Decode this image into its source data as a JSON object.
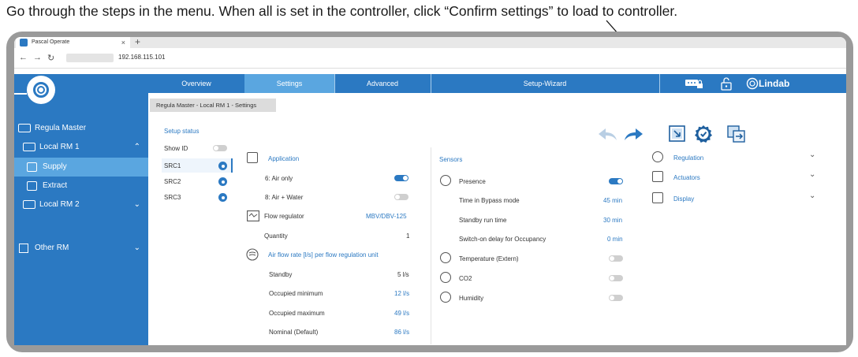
{
  "instruction": "Go through the steps in the menu. When all is set in the controller, click “Confirm settings” to load to controller.",
  "browser": {
    "tab_title": "Pascal Operate",
    "tab_close": "×",
    "new_tab": "+",
    "url": "192.168.115.101",
    "back": "←",
    "forward": "→",
    "reload": "↻"
  },
  "topnav": {
    "tabs": [
      {
        "label": "Overview"
      },
      {
        "label": "Settings",
        "active": true
      },
      {
        "label": "Advanced"
      },
      {
        "label": "Setup-Wizard"
      }
    ],
    "brand": "Lindab"
  },
  "sidebar": {
    "items": [
      {
        "label": "Regula Master",
        "icon": "controller-icon"
      },
      {
        "label": "Local RM 1",
        "icon": "controller-icon",
        "expanded": true
      },
      {
        "label": "Supply",
        "icon": "unit-icon",
        "selected": true
      },
      {
        "label": "Extract",
        "icon": "unit-icon"
      },
      {
        "label": "Local RM 2",
        "icon": "controller-icon",
        "expanded": false
      },
      {
        "label": "Other RM",
        "icon": "building-icon",
        "expanded": false
      }
    ]
  },
  "breadcrumb": "Regula Master - Local RM 1 - Settings",
  "setup": {
    "title": "Setup status",
    "show_id_label": "Show ID",
    "show_id_on": false,
    "srcs": [
      {
        "label": "SRC1",
        "selected": true
      },
      {
        "label": "SRC2"
      },
      {
        "label": "SRC3"
      }
    ]
  },
  "application": {
    "title": "Application",
    "options": [
      {
        "label": "6: Air only",
        "on": true
      },
      {
        "label": "8: Air + Water",
        "on": false
      }
    ],
    "flow_regulator_label": "Flow regulator",
    "flow_regulator_value": "MBV/DBV-125",
    "quantity_label": "Quantity",
    "quantity_value": "1",
    "airflow_title": "Air flow rate [l/s] per flow regulation unit",
    "rates": [
      {
        "label": "Standby",
        "value": "5 l/s"
      },
      {
        "label": "Occupied minimum",
        "value": "12 l/s"
      },
      {
        "label": "Occupied maximum",
        "value": "49 l/s"
      },
      {
        "label": "Nominal (Default)",
        "value": "86 l/s"
      }
    ]
  },
  "sensors": {
    "title": "Sensors",
    "presence_label": "Presence",
    "presence_on": true,
    "presence_settings": [
      {
        "label": "Time in Bypass mode",
        "value": "45 min"
      },
      {
        "label": "Standby run time",
        "value": "30 min"
      },
      {
        "label": "Switch-on delay for Occupancy",
        "value": "0 min"
      }
    ],
    "others": [
      {
        "label": "Temperature (Extern)",
        "on": false
      },
      {
        "label": "CO2",
        "on": false
      },
      {
        "label": "Humidity",
        "on": false
      }
    ]
  },
  "right_sections": [
    {
      "label": "Regulation"
    },
    {
      "label": "Actuators"
    },
    {
      "label": "Display"
    }
  ],
  "colors": {
    "brand_blue": "#2b79c2",
    "active_tab": "#5aa6e0"
  }
}
